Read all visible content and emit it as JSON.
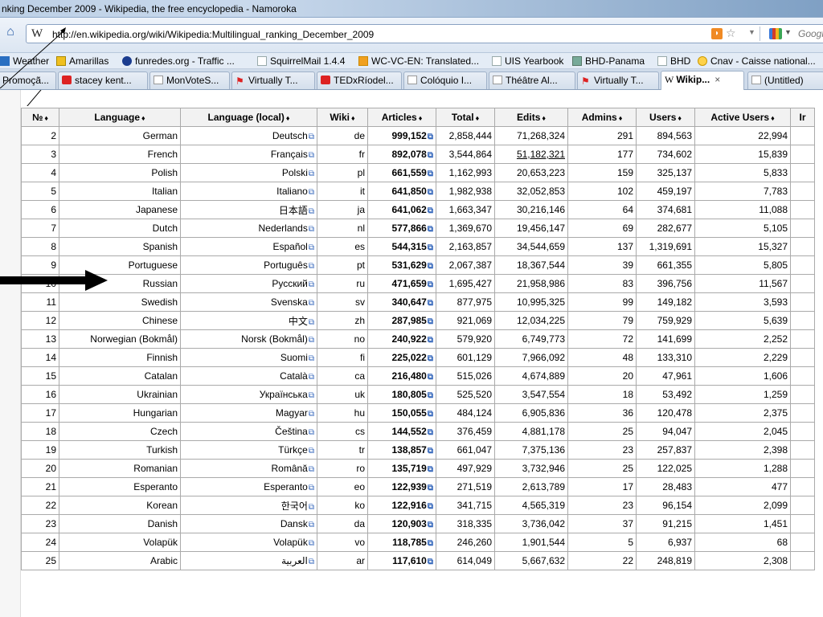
{
  "window": {
    "title": "nking December 2009 - Wikipedia, the free encyclopedia - Namoroka"
  },
  "nav": {
    "url": "http://en.wikipedia.org/wiki/Wikipedia:Multilingual_ranking_December_2009",
    "search_placeholder": "Google",
    "icons": [
      "home-icon",
      "rss-icon",
      "star-icon",
      "google-icon"
    ]
  },
  "bookmarks": [
    "Weather",
    "Amarillas",
    "funredes.org - Traffic ...",
    "SquirrelMail 1.4.4",
    "WC-VC-EN: Translated...",
    "UIS Yearbook",
    "BHD-Panama",
    "BHD",
    "Cnav - Caisse national..."
  ],
  "tabs": [
    {
      "label": "Promoçã...",
      "icon": "none"
    },
    {
      "label": "stacey kent...",
      "icon": "youtube-icon"
    },
    {
      "label": "MonVoteS...",
      "icon": "doc-icon"
    },
    {
      "label": "Virtually T...",
      "icon": "red-icon"
    },
    {
      "label": "TEDxRíodel...",
      "icon": "youtube-icon"
    },
    {
      "label": "Colóquio I...",
      "icon": "doc-icon"
    },
    {
      "label": "Théâtre Al...",
      "icon": "doc-icon"
    },
    {
      "label": "Virtually T...",
      "icon": "red-icon"
    },
    {
      "label": "Wikip...",
      "icon": "wikipedia-icon",
      "active": true
    },
    {
      "label": "(Untitled)",
      "icon": "doc-icon"
    }
  ],
  "table": {
    "headers": [
      "№",
      "Language",
      "Language (local)",
      "Wiki",
      "Articles",
      "Total",
      "Edits",
      "Admins",
      "Users",
      "Active Users",
      "Ir"
    ],
    "sort_glyph": "♦",
    "ext_glyph": "⧉",
    "rows": [
      [
        "2",
        "German",
        "Deutsch",
        "de",
        "999,152",
        "2,858,444",
        "71,268,324",
        "291",
        "894,563",
        "22,994"
      ],
      [
        "3",
        "French",
        "Français",
        "fr",
        "892,078",
        "3,544,864",
        "51,182,321",
        "177",
        "734,602",
        "15,839"
      ],
      [
        "4",
        "Polish",
        "Polski",
        "pl",
        "661,559",
        "1,162,993",
        "20,653,223",
        "159",
        "325,137",
        "5,833"
      ],
      [
        "5",
        "Italian",
        "Italiano",
        "it",
        "641,850",
        "1,982,938",
        "32,052,853",
        "102",
        "459,197",
        "7,783"
      ],
      [
        "6",
        "Japanese",
        "日本語",
        "ja",
        "641,062",
        "1,663,347",
        "30,216,146",
        "64",
        "374,681",
        "11,088"
      ],
      [
        "7",
        "Dutch",
        "Nederlands",
        "nl",
        "577,866",
        "1,369,670",
        "19,456,147",
        "69",
        "282,677",
        "5,105"
      ],
      [
        "8",
        "Spanish",
        "Español",
        "es",
        "544,315",
        "2,163,857",
        "34,544,659",
        "137",
        "1,319,691",
        "15,327"
      ],
      [
        "9",
        "Portuguese",
        "Português",
        "pt",
        "531,629",
        "2,067,387",
        "18,367,544",
        "39",
        "661,355",
        "5,805"
      ],
      [
        "10",
        "Russian",
        "Русский",
        "ru",
        "471,659",
        "1,695,427",
        "21,958,986",
        "83",
        "396,756",
        "11,567"
      ],
      [
        "11",
        "Swedish",
        "Svenska",
        "sv",
        "340,647",
        "877,975",
        "10,995,325",
        "99",
        "149,182",
        "3,593"
      ],
      [
        "12",
        "Chinese",
        "中文",
        "zh",
        "287,985",
        "921,069",
        "12,034,225",
        "79",
        "759,929",
        "5,639"
      ],
      [
        "13",
        "Norwegian (Bokmål)",
        "Norsk (Bokmål)",
        "no",
        "240,922",
        "579,920",
        "6,749,773",
        "72",
        "141,699",
        "2,252"
      ],
      [
        "14",
        "Finnish",
        "Suomi",
        "fi",
        "225,022",
        "601,129",
        "7,966,092",
        "48",
        "133,310",
        "2,229"
      ],
      [
        "15",
        "Catalan",
        "Català",
        "ca",
        "216,480",
        "515,026",
        "4,674,889",
        "20",
        "47,961",
        "1,606"
      ],
      [
        "16",
        "Ukrainian",
        "Українська",
        "uk",
        "180,805",
        "525,520",
        "3,547,554",
        "18",
        "53,492",
        "1,259"
      ],
      [
        "17",
        "Hungarian",
        "Magyar",
        "hu",
        "150,055",
        "484,124",
        "6,905,836",
        "36",
        "120,478",
        "2,375"
      ],
      [
        "18",
        "Czech",
        "Čeština",
        "cs",
        "144,552",
        "376,459",
        "4,881,178",
        "25",
        "94,047",
        "2,045"
      ],
      [
        "19",
        "Turkish",
        "Türkçe",
        "tr",
        "138,857",
        "661,047",
        "7,375,136",
        "23",
        "257,837",
        "2,398"
      ],
      [
        "20",
        "Romanian",
        "Română",
        "ro",
        "135,719",
        "497,929",
        "3,732,946",
        "25",
        "122,025",
        "1,288"
      ],
      [
        "21",
        "Esperanto",
        "Esperanto",
        "eo",
        "122,939",
        "271,519",
        "2,613,789",
        "17",
        "28,483",
        "477"
      ],
      [
        "22",
        "Korean",
        "한국어",
        "ko",
        "122,916",
        "341,715",
        "4,565,319",
        "23",
        "96,154",
        "2,099"
      ],
      [
        "23",
        "Danish",
        "Dansk",
        "da",
        "120,903",
        "318,335",
        "3,736,042",
        "37",
        "91,215",
        "1,451"
      ],
      [
        "24",
        "Volapük",
        "Volapük",
        "vo",
        "118,785",
        "246,260",
        "1,901,544",
        "5",
        "6,937",
        "68"
      ],
      [
        "25",
        "Arabic",
        "العربية",
        "ar",
        "117,610",
        "614,049",
        "5,667,632",
        "22",
        "248,819",
        "2,308"
      ]
    ]
  }
}
